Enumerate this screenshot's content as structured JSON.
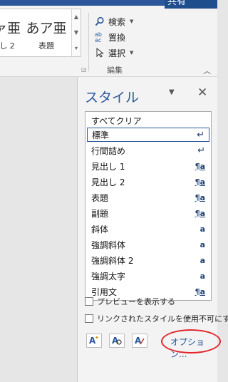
{
  "ribbon": {
    "share_label": "共有",
    "gallery": {
      "items": [
        {
          "preview": "ァ亜",
          "name": "し 2"
        },
        {
          "preview": "あア亜",
          "name": "表題"
        }
      ]
    },
    "editing": {
      "find_label": "検索",
      "replace_label": "置換",
      "select_label": "選択",
      "group_label": "編集"
    }
  },
  "pane": {
    "title": "スタイル",
    "styles": [
      {
        "name": "すべてクリア",
        "mark": ""
      },
      {
        "name": "標準",
        "mark": "↵"
      },
      {
        "name": "行間詰め",
        "mark": "↵"
      },
      {
        "name": "見出し 1",
        "mark": "¶a"
      },
      {
        "name": "見出し 2",
        "mark": "¶a"
      },
      {
        "name": "表題",
        "mark": "¶a"
      },
      {
        "name": "副題",
        "mark": "¶a"
      },
      {
        "name": "斜体",
        "mark": "a"
      },
      {
        "name": "強調斜体",
        "mark": "a"
      },
      {
        "name": "強調斜体 2",
        "mark": "a"
      },
      {
        "name": "強調太字",
        "mark": "a"
      },
      {
        "name": "引用文",
        "mark": "¶a"
      }
    ],
    "show_preview_label": "プレビューを表示する",
    "disable_linked_label": "リンクされたスタイルを使用不可にす",
    "options_label": "オプション..."
  }
}
